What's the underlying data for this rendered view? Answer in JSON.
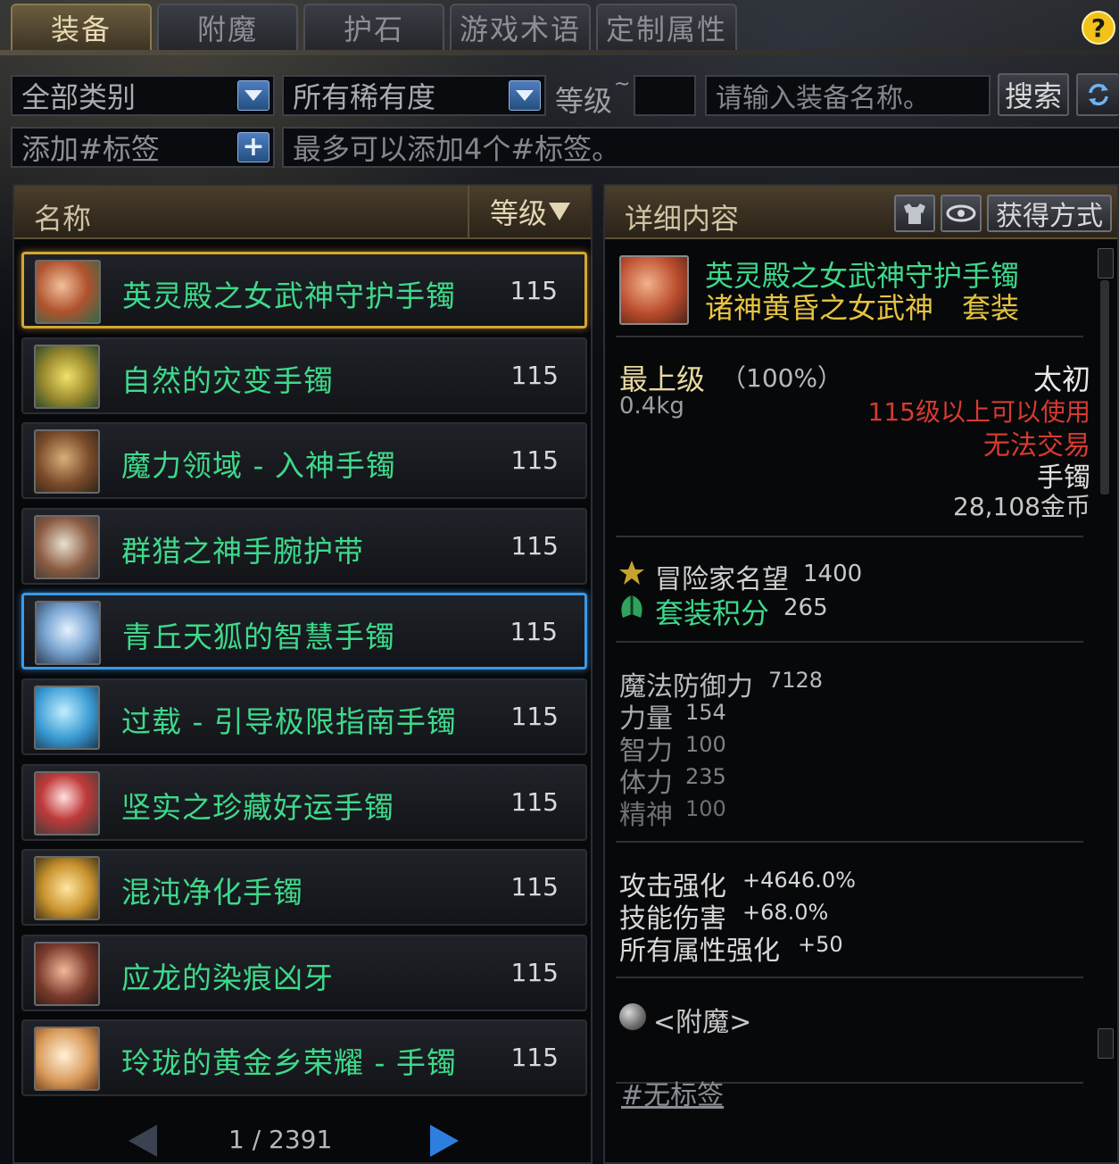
{
  "tabs": [
    "装备",
    "附魔",
    "护石",
    "游戏术语",
    "定制属性"
  ],
  "help_label": "?",
  "filters": {
    "category": "全部类别",
    "rarity": "所有稀有度",
    "level_label": "等级",
    "level_tilde": "~",
    "level_value": "",
    "name_placeholder": "请输入装备名称。",
    "search_label": "搜索",
    "refresh_icon": "refresh-icon",
    "tag_label": "添加#标签",
    "tag_hint": "最多可以添加4个#标签。"
  },
  "list": {
    "header_name": "名称",
    "header_level": "等级",
    "items": [
      {
        "name": "英灵殿之女武神守护手镯",
        "level": "115",
        "highlight": "gold"
      },
      {
        "name": "自然的灾变手镯",
        "level": "115",
        "highlight": "none"
      },
      {
        "name": "魔力领域 - 入神手镯",
        "level": "115",
        "highlight": "none"
      },
      {
        "name": "群猎之神手腕护带",
        "level": "115",
        "highlight": "none"
      },
      {
        "name": "青丘天狐的智慧手镯",
        "level": "115",
        "highlight": "blue"
      },
      {
        "name": "过载 - 引导极限指南手镯",
        "level": "115",
        "highlight": "none"
      },
      {
        "name": "坚实之珍藏好运手镯",
        "level": "115",
        "highlight": "none"
      },
      {
        "name": "混沌净化手镯",
        "level": "115",
        "highlight": "none"
      },
      {
        "name": "应龙的染痕凶牙",
        "level": "115",
        "highlight": "none"
      },
      {
        "name": "玲珑的黄金乡荣耀 - 手镯",
        "level": "115",
        "highlight": "none"
      }
    ],
    "pager": "1 / 2391"
  },
  "detail": {
    "header": "详细内容",
    "obtain_label": "获得方式",
    "item_name": "英灵殿之女武神守护手镯",
    "set_name": "诸神黄昏之女武神　套装",
    "grade": "最上级",
    "grade_pct": "（100%）",
    "tier": "太初",
    "weight": "0.4kg",
    "req": "115级以上可以使用",
    "trade": "无法交易",
    "slot": "手镯",
    "price": "28,108金币",
    "fame_label": "冒险家名望",
    "fame_value": "1400",
    "set_points_label": "套装积分",
    "set_points_value": "265",
    "stats": [
      {
        "label": "魔法防御力",
        "value": "7128"
      },
      {
        "label": "力量",
        "value": "154"
      },
      {
        "label": "智力",
        "value": "100"
      },
      {
        "label": "体力",
        "value": "235"
      },
      {
        "label": "精神",
        "value": "100"
      }
    ],
    "bonuses": [
      {
        "label": "攻击强化",
        "value": "+4646.0%"
      },
      {
        "label": "技能伤害",
        "value": "+68.0%"
      },
      {
        "label": "所有属性强化",
        "value": "+50"
      }
    ],
    "enchant_label": "<附魔>",
    "tag_text": "#无标签"
  },
  "colors": {
    "item_green": "#3ed98a",
    "set_gold": "#e6c440",
    "req_red": "#d83a30",
    "select_gold": "#d5a632",
    "select_blue": "#3a9ae8"
  }
}
